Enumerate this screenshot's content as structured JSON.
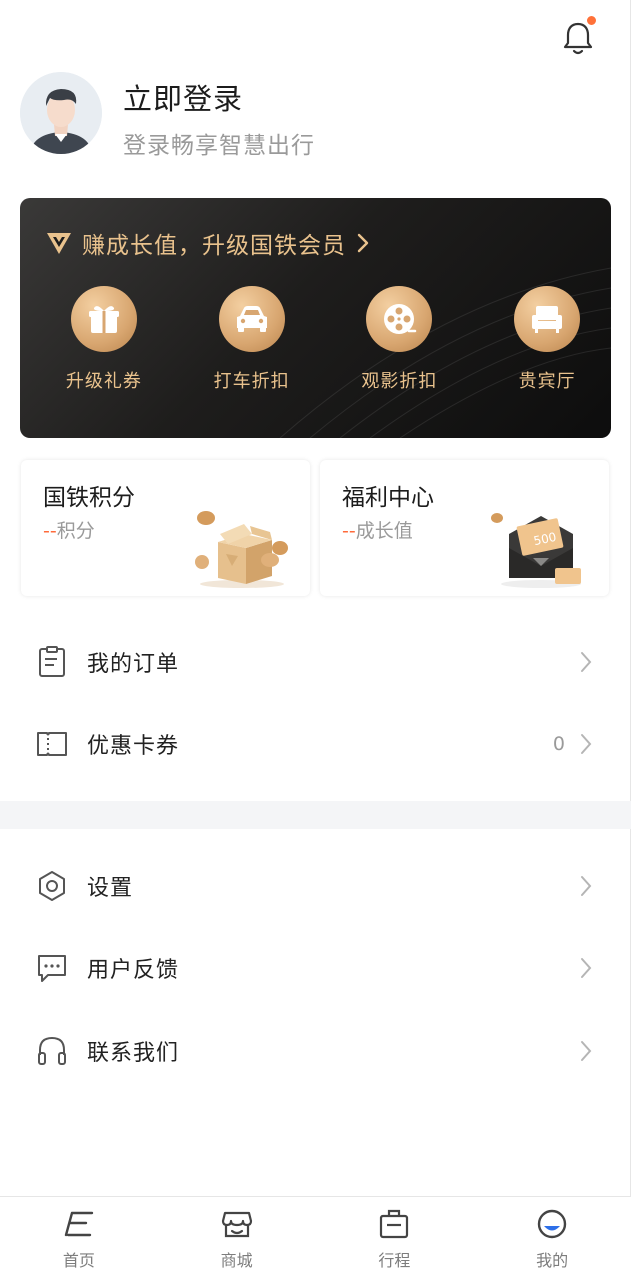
{
  "header": {
    "notification_icon": "bell-icon",
    "notification_dot_color": "#ff7139",
    "login_title": "立即登录",
    "login_subtitle": "登录畅享智慧出行"
  },
  "member_card": {
    "headline": "赚成长值，升级国铁会员",
    "perks": [
      {
        "label": "升级礼券",
        "icon": "gift-icon"
      },
      {
        "label": "打车折扣",
        "icon": "car-icon"
      },
      {
        "label": "观影折扣",
        "icon": "film-reel-icon"
      },
      {
        "label": "贵宾厅",
        "icon": "armchair-icon"
      }
    ],
    "accent_color": "#e9c28d"
  },
  "points_cards": [
    {
      "title": "国铁积分",
      "dash": "--",
      "unit": "积分"
    },
    {
      "title": "福利中心",
      "dash": "--",
      "unit": "成长值"
    }
  ],
  "envelope_amount": "500",
  "menu_group1": [
    {
      "label": "我的订单",
      "icon": "clipboard-icon"
    },
    {
      "label": "优惠卡券",
      "icon": "ticket-icon",
      "count": "0"
    }
  ],
  "menu_group2": [
    {
      "label": "设置",
      "icon": "settings-icon"
    },
    {
      "label": "用户反馈",
      "icon": "feedback-icon"
    },
    {
      "label": "联系我们",
      "icon": "headset-icon"
    }
  ],
  "tabbar": [
    {
      "label": "首页",
      "icon": "home-icon"
    },
    {
      "label": "商城",
      "icon": "store-icon"
    },
    {
      "label": "行程",
      "icon": "briefcase-icon"
    },
    {
      "label": "我的",
      "icon": "profile-icon",
      "active": true
    }
  ],
  "active_tab_color": "#2d6fe8"
}
